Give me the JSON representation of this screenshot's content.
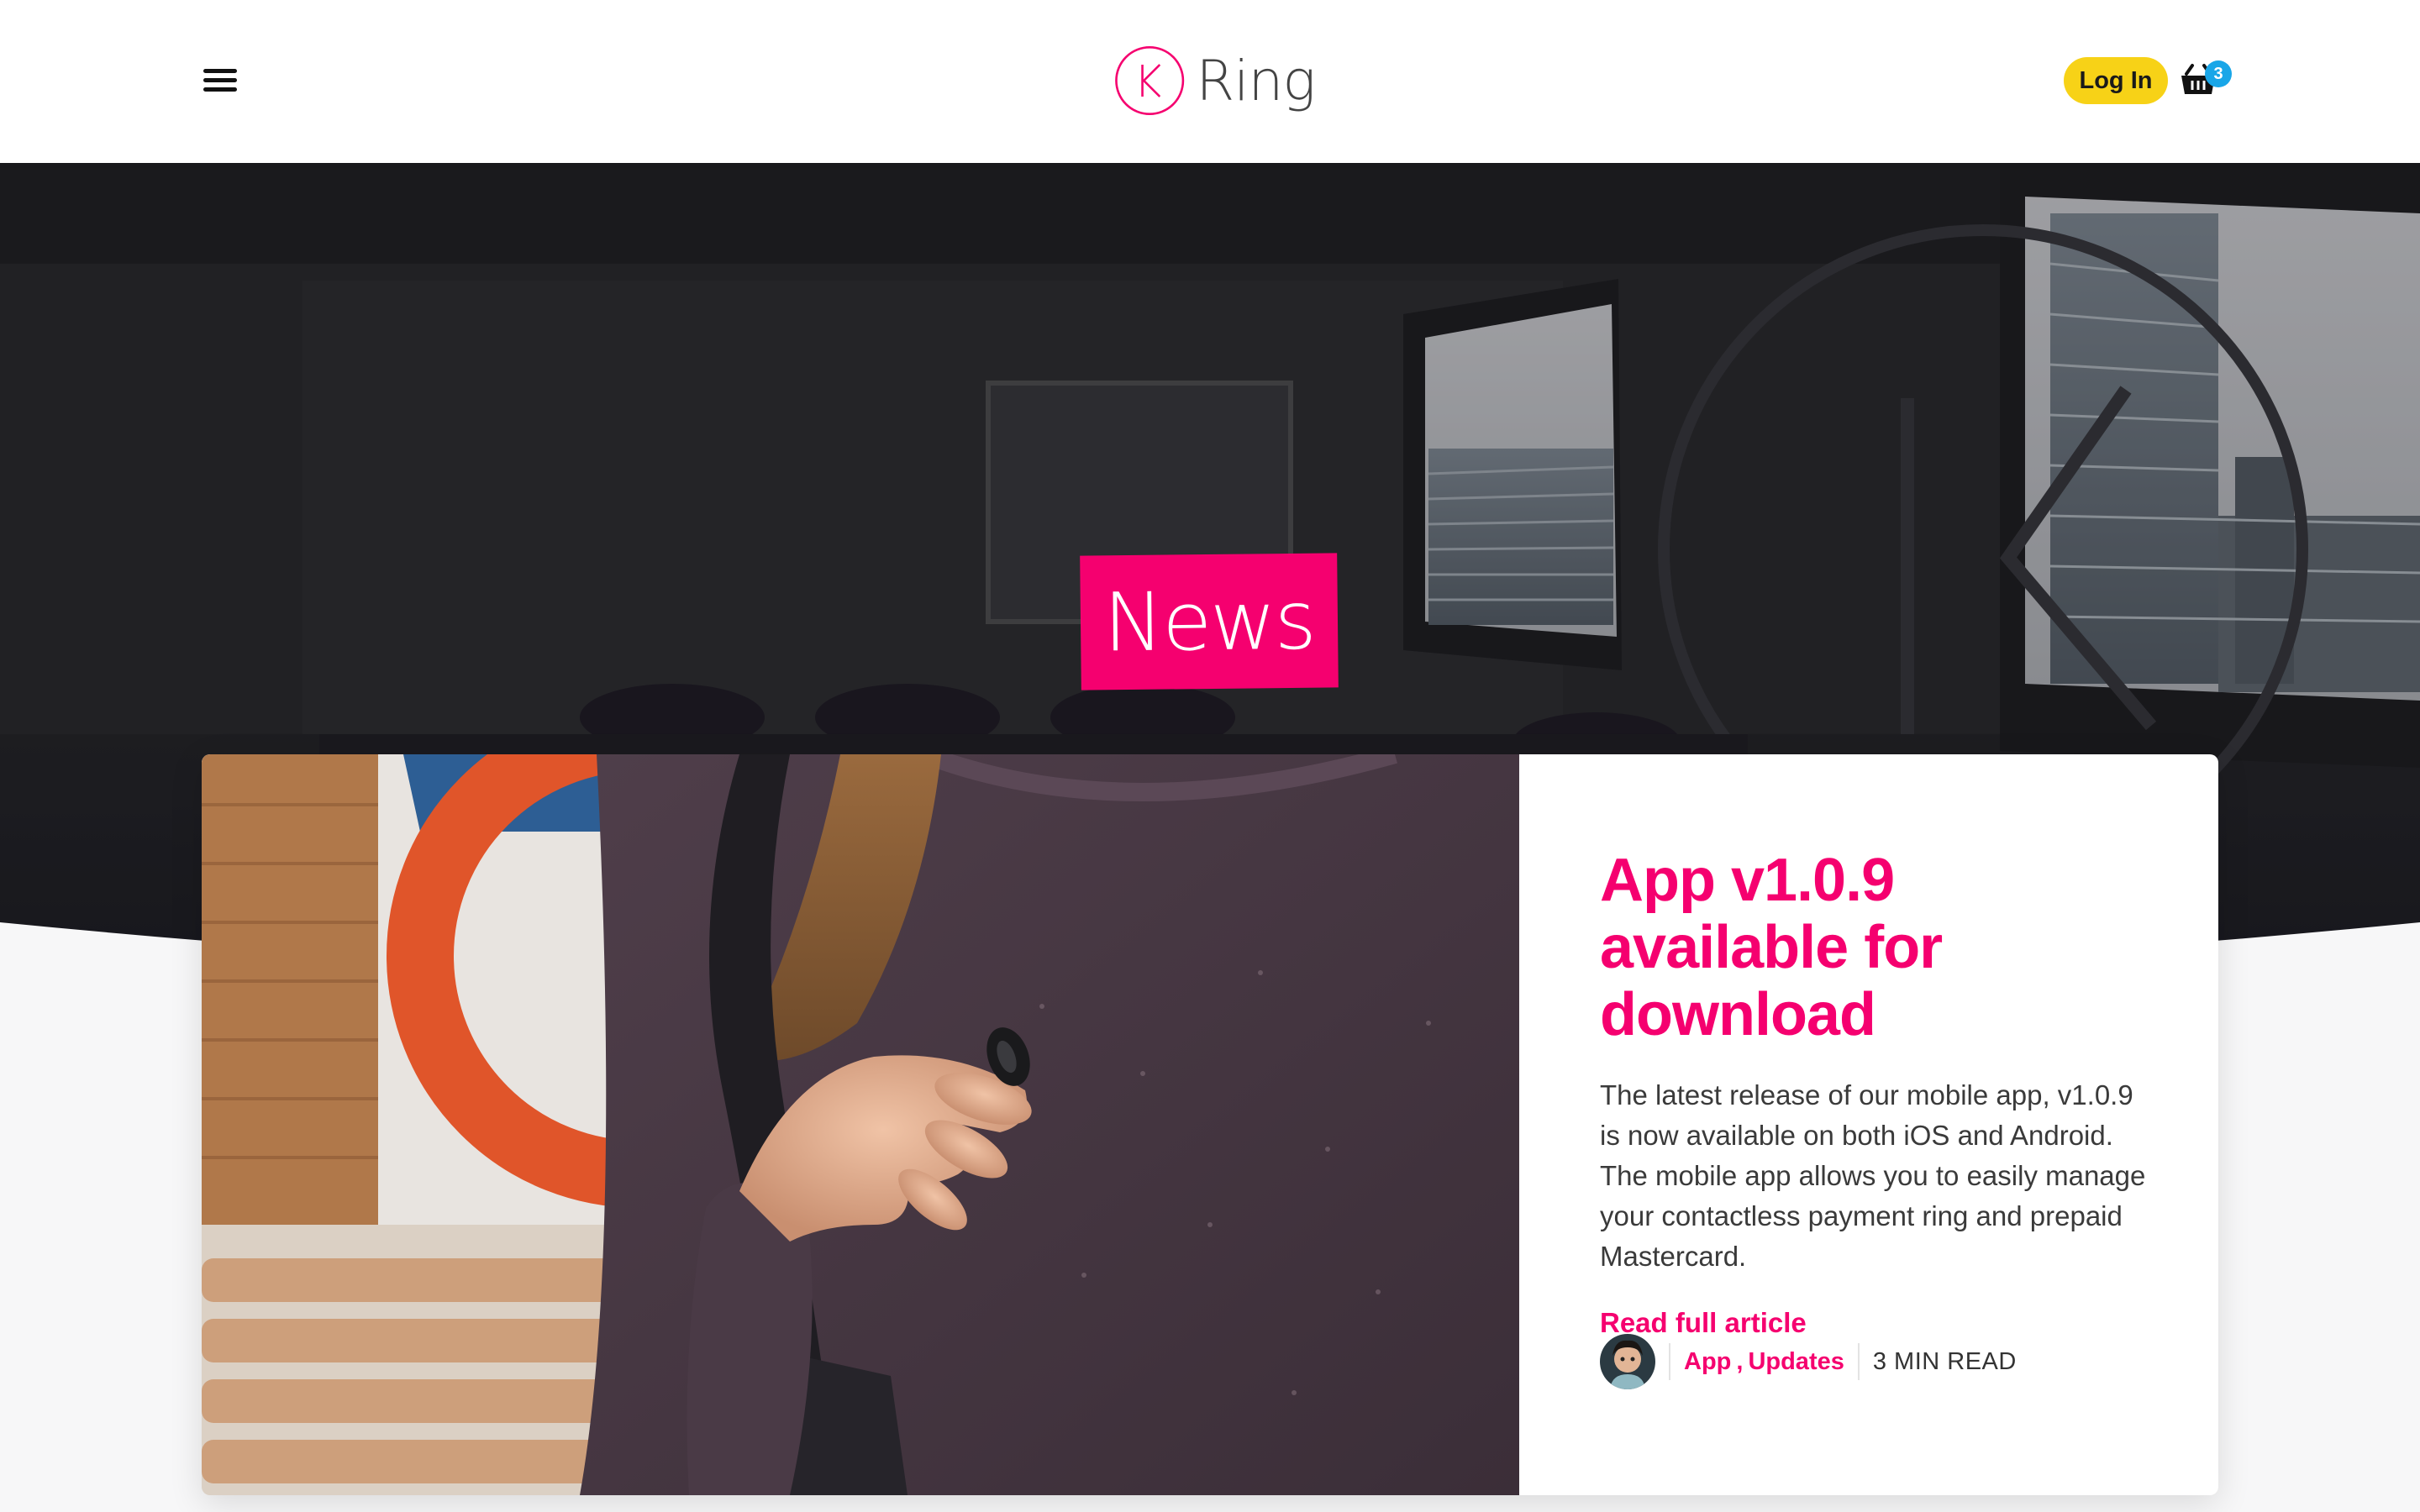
{
  "header": {
    "logo_text": "Ring",
    "login_label": "Log In",
    "cart_count": "3"
  },
  "hero": {
    "title": "News"
  },
  "article": {
    "title": "App v1.0.9 available for download",
    "excerpt": "The latest release of our mobile app, v1.0.9 is now available on both iOS and Android. The mobile app allows you to easily manage your contactless payment ring and prepaid Mastercard.",
    "read_more_label": "Read full article",
    "tags": [
      "App",
      "Updates"
    ],
    "tag_separator": ",",
    "read_time": "3 MIN READ"
  },
  "colors": {
    "brand_pink": "#f5006f",
    "login_yellow": "#f7d217",
    "badge_blue": "#19a6e8"
  }
}
